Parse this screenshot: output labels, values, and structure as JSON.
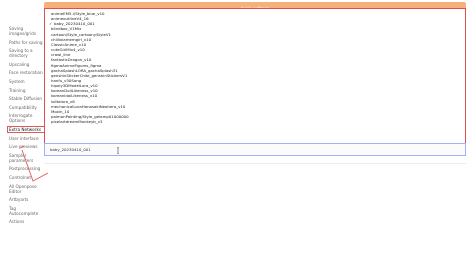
{
  "toolbar": {
    "apply_label": "Apply settings"
  },
  "sidebar": {
    "items": [
      "Saving\nimages/grids",
      "Paths for saving",
      "Saving to a\ndirectory",
      "Upscaling",
      "Face restoration",
      "System",
      "Training",
      "Stable Diffusion",
      "Compatibility",
      "Interrogate\nOptions",
      "Extra Networks",
      "User interface",
      "Live previews",
      "Sampler\nparameters",
      "Postprocessing",
      "Controlnet",
      "All Openpose\nEditor",
      "Artbyarts",
      "Tag\nAutocomplete",
      "Actions"
    ],
    "active_index": 10
  },
  "dropdown": {
    "options": [
      "animeEM5-l/Style_blue_v10",
      "animeoutlineV4_16",
      "baby_20230410_001",
      "blindbox_V1Mix",
      "cartoon/Style_cartoonyStyleV1",
      "chillixiamemgirl_v10",
      "ClassicAnime_v10",
      "cuteGirlMix4_v10",
      "crawl_line",
      "fantasticDragon_v10",
      "figmaAnimeFigures_figma",
      "gachaSplashLORA_gachaSplash31",
      "genshinStickerChibi_genshinStickersV1",
      "hanfu_v30Song",
      "hipoly3DModelLora_v10",
      "koreanDollLikeness_v10",
      "koreanidolLikeness_v10",
      "lolitalora_v8",
      "mechanicalLoraHanasakiNeohero_v10",
      "Moxin_10",
      "paimonPainting/Style_gelamp01000000",
      "pixelartdreamMonkeyb_v3"
    ],
    "selected_index": 2,
    "checkmark": "✓"
  },
  "input": {
    "value": "baby_20230410_001"
  }
}
